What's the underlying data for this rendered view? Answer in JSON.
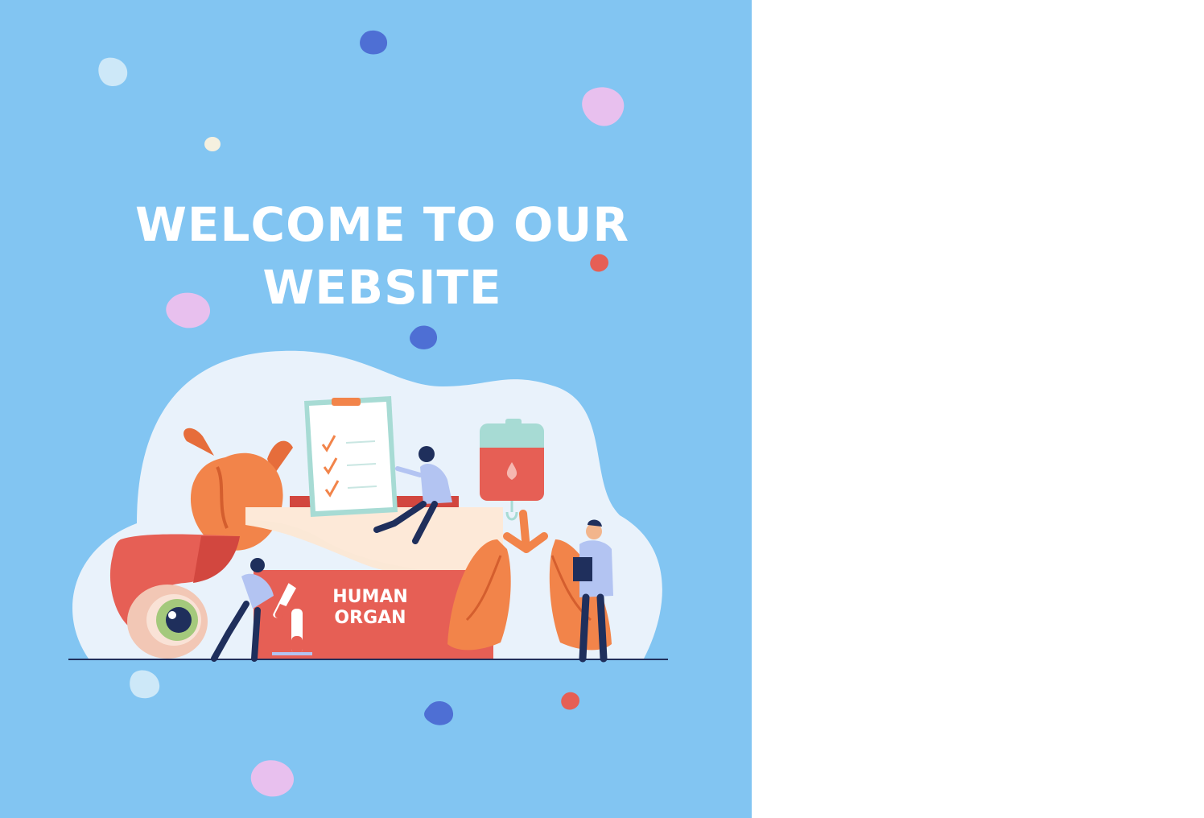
{
  "hero": {
    "title_line1": "WELCOME TO OUR",
    "title_line2": "WEBSITE",
    "background_color": "#82c5f2"
  },
  "illustration": {
    "box_label_line1": "HUMAN",
    "box_label_line2": "ORGAN",
    "icons": [
      "heart-icon",
      "liver-icon",
      "eye-icon",
      "lungs-icon",
      "blood-bag-icon",
      "clipboard-icon",
      "test-tube-icon"
    ]
  },
  "colors": {
    "accent_red": "#e65f55",
    "organ_orange": "#f2844a",
    "dark_navy": "#1f2f5c",
    "blob_blue": "#4e6fd4",
    "blob_pink": "#e8c0ee",
    "blob_lightblue": "#cde8f8"
  }
}
